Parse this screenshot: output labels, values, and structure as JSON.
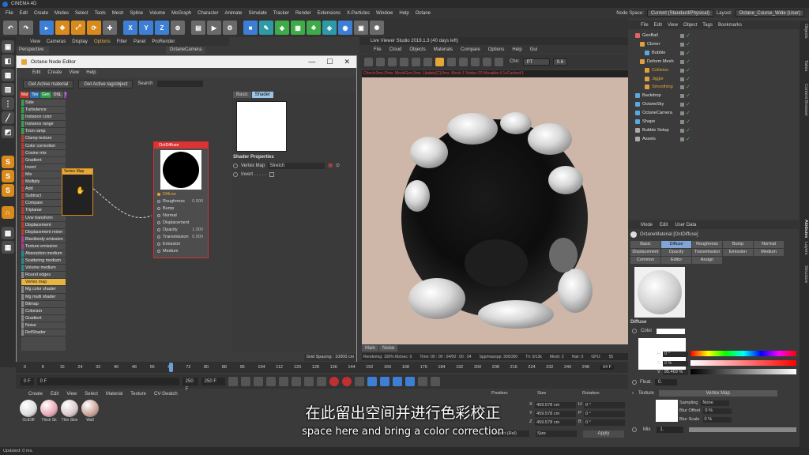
{
  "app": {
    "title": "CINEMA 4D",
    "statusbar": "Updated: 0 ms."
  },
  "menubar": {
    "items": [
      "File",
      "Edit",
      "Create",
      "Modes",
      "Select",
      "Tools",
      "Mesh",
      "Spline",
      "Volume",
      "MoGraph",
      "Character",
      "Animate",
      "Simulate",
      "Tracker",
      "Render",
      "Extensions",
      "X-Particles",
      "Window",
      "Help",
      "Octane"
    ],
    "node_space_label": "Node Space:",
    "node_space_value": "Current (Standard/Physical)",
    "layout_label": "Layout:",
    "layout_value": "Octane_Course_Wide (User)"
  },
  "toolbar": {
    "axis_x": "X",
    "axis_y": "Y",
    "axis_z": "Z"
  },
  "viewport": {
    "menu": [
      "View",
      "Cameras",
      "Display",
      "Options",
      "Filter",
      "Panel",
      "ProRender"
    ],
    "mode": "Perspective",
    "camera": "OctaneCamera"
  },
  "node_editor": {
    "title": "Octane Node Editor",
    "menu": [
      "Edit",
      "Create",
      "View",
      "Help"
    ],
    "get_material_button": "Get Active material",
    "get_tag_button": "Get Active tag/object",
    "search_label": "Search",
    "category_tabs": [
      {
        "label": "Mat",
        "color": "#c0392b"
      },
      {
        "label": "Tex",
        "color": "#2f6fb5"
      },
      {
        "label": "Gen",
        "color": "#2e9a4a"
      },
      {
        "label": "OSL",
        "color": "#555555"
      },
      {
        "label": "Map",
        "color": "#8e44ad"
      },
      {
        "label": "Oth",
        "color": "#7f5a30"
      },
      {
        "label": "Ems",
        "color": "#b03a8e"
      },
      {
        "label": "Med",
        "color": "#2a8a8a"
      },
      {
        "label": "C4D",
        "color": "#222222"
      }
    ],
    "node_list": [
      {
        "label": "Side",
        "color": "#3aa050"
      },
      {
        "label": "Turbulence",
        "color": "#3aa050"
      },
      {
        "label": "Instance color",
        "color": "#3aa050"
      },
      {
        "label": "Instance range",
        "color": "#3aa050"
      },
      {
        "label": "Toon ramp",
        "color": "#3aa050"
      },
      {
        "label": "Clamp texture",
        "color": "#c0392b"
      },
      {
        "label": "Color correction",
        "color": "#c0392b"
      },
      {
        "label": "Cosine mix",
        "color": "#c0392b"
      },
      {
        "label": "Gradient",
        "color": "#c0392b"
      },
      {
        "label": "Invert",
        "color": "#c0392b"
      },
      {
        "label": "Mix",
        "color": "#c0392b"
      },
      {
        "label": "Multiply",
        "color": "#c0392b"
      },
      {
        "label": "Add",
        "color": "#c0392b"
      },
      {
        "label": "Subtract",
        "color": "#c0392b"
      },
      {
        "label": "Compare",
        "color": "#c0392b"
      },
      {
        "label": "Triplanar",
        "color": "#c0392b"
      },
      {
        "label": "Uvw transform",
        "color": "#c0392b"
      },
      {
        "label": "Displacement",
        "color": "#c0392b"
      },
      {
        "label": "Displacement mixer",
        "color": "#c0392b"
      },
      {
        "label": "Blackbody emission",
        "color": "#b03a8e"
      },
      {
        "label": "Texture emission",
        "color": "#b03a8e"
      },
      {
        "label": "Absorption medium",
        "color": "#2a8a8a"
      },
      {
        "label": "Scattering medium",
        "color": "#2a8a8a"
      },
      {
        "label": "Volume medium",
        "color": "#2a8a8a"
      },
      {
        "label": "Round edges",
        "color": "#888888"
      },
      {
        "label": "Vertex map",
        "color": "#e7b341",
        "selected": true
      },
      {
        "label": "Mg color shader",
        "color": "#888888"
      },
      {
        "label": "Mg multi shader",
        "color": "#888888"
      },
      {
        "label": "Bitmap",
        "color": "#888888"
      },
      {
        "label": "Colorizer",
        "color": "#888888"
      },
      {
        "label": "Gradient",
        "color": "#888888"
      },
      {
        "label": "Noise",
        "color": "#888888"
      },
      {
        "label": "RefShader",
        "color": "#888888"
      }
    ],
    "vertex_node_title": "Vertex Map",
    "diffuse_node": {
      "title": "OctDiffuse",
      "ports": [
        {
          "label": "Diffuse",
          "value": "",
          "active": true
        },
        {
          "label": "Roughness",
          "value": "0.000"
        },
        {
          "label": "Bump",
          "value": ""
        },
        {
          "label": "Normal",
          "value": ""
        },
        {
          "label": "Displacement",
          "value": ""
        },
        {
          "label": "Opacity",
          "value": "1.000"
        },
        {
          "label": "Transmission",
          "value": "0.000"
        },
        {
          "label": "Emission",
          "value": ""
        },
        {
          "label": "Medium",
          "value": ""
        }
      ]
    },
    "shader_tabs": [
      "Basic",
      "Shader"
    ],
    "shader_properties_label": "Shader Properties",
    "vertex_map_label": "Vertex Map",
    "vertex_map_value": "Stretch",
    "invert_label": "Invert . . . . .",
    "grid_spacing": "Grid Spacing : 10000 cm"
  },
  "live_viewer": {
    "title": "Live Viewer Studio 2019.1.3 (40 days left)",
    "menu": [
      "File",
      "Cloud",
      "Objects",
      "Materials",
      "Compare",
      "Options",
      "Help",
      "Gui"
    ],
    "channel_label": "Chn:",
    "channel_value": "PT",
    "zoom_value": "0.6",
    "status": "Check:0ms./0ms. MeshGen:2ms. Update[C]:0ms. Mesh:1 Nodes:20 Movable:4 1xCached:1",
    "tabs": [
      "Main",
      "Noise"
    ],
    "footer": [
      "Rendering: 100% Ms/sec: 0",
      "Time: 00 : 00 : 04/00 : 00 : 04",
      "Spp/maxspp: 300/300",
      "Tri: 0/13k",
      "Mesh: 2",
      "Hair: 0",
      "GPU:",
      "55"
    ]
  },
  "object_manager": {
    "menu": [
      "File",
      "Edit",
      "View",
      "Object",
      "Tags",
      "Bookmarks"
    ],
    "objects": [
      {
        "name": "GeoBall",
        "color": "#e06666",
        "indent": 0
      },
      {
        "name": "Cloner",
        "color": "#e0a040",
        "indent": 1
      },
      {
        "name": "Bubble",
        "color": "#5aa8e0",
        "indent": 2
      },
      {
        "name": "Deform Mesh",
        "color": "#e0a040",
        "indent": 1
      },
      {
        "name": "Collision",
        "color": "#e0a040",
        "indent": 2
      },
      {
        "name": "Jiggle",
        "color": "#e0a040",
        "indent": 2
      },
      {
        "name": "Smoothing",
        "color": "#e0a040",
        "indent": 2
      },
      {
        "name": "Backdrop",
        "color": "#5aa8e0",
        "indent": 0
      },
      {
        "name": "OctaneSky",
        "color": "#5aa8e0",
        "indent": 0
      },
      {
        "name": "OctaneCamera",
        "color": "#5aa8e0",
        "indent": 0
      },
      {
        "name": "Shape",
        "color": "#5aa8e0",
        "indent": 0
      },
      {
        "name": "Bubble Setup",
        "color": "#aaaaaa",
        "indent": 0
      },
      {
        "name": "Assets",
        "color": "#aaaaaa",
        "indent": 0
      }
    ]
  },
  "attributes": {
    "menu": [
      "Mode",
      "Edit",
      "User Data"
    ],
    "title": "OctaneMaterial [OctDiffuse]",
    "tabs": [
      "Basic",
      "Diffuse",
      "Roughness",
      "Bump",
      "Normal",
      "Displacement",
      "Opacity",
      "Transmission",
      "Emission",
      "Medium",
      "Common",
      "Editor",
      "Assign"
    ],
    "active_tab": "Diffuse",
    "section": "Diffuse",
    "color_label": "Color",
    "h_label": "H",
    "h_value": "0 °",
    "s_label": "S",
    "s_value": "0 %",
    "v_label": "V",
    "v_value": "95.469 %",
    "float_label": "Float.",
    "float_value": "0.",
    "texture_label": "Texture",
    "texture_value": "Vertex Map",
    "sampling_label": "Sampling",
    "sampling_value": "None",
    "blur_offset_label": "Blur Offset",
    "blur_offset_value": "0 %",
    "blur_scale_label": "Blur Scale",
    "blur_scale_value": "0 %",
    "mix_label": "Mix",
    "mix_value": "1."
  },
  "right_tabs": [
    "Objects",
    "Takes",
    "Content Browser",
    "Layers",
    "Structure",
    "Attributes"
  ],
  "timeline": {
    "ticks": [
      "0",
      "8",
      "16",
      "24",
      "32",
      "40",
      "48",
      "56",
      "64",
      "72",
      "80",
      "88",
      "96",
      "104",
      "112",
      "120",
      "128",
      "136",
      "144",
      "152",
      "160",
      "168",
      "176",
      "184",
      "192",
      "200",
      "208",
      "216",
      "224",
      "232",
      "240",
      "248",
      "F"
    ],
    "current": "64 F",
    "start_a": "0 F",
    "start_b": "0 F",
    "end_a": "250 F",
    "end_b": "250 F"
  },
  "materials": {
    "menu": [
      "Create",
      "Edit",
      "View",
      "Select",
      "Material",
      "Texture",
      "CV-Swatch"
    ],
    "items": [
      {
        "label": "OctDiff",
        "color": "#dcdcdc"
      },
      {
        "label": "Thick Sk",
        "color": "#e8a8b4"
      },
      {
        "label": "Thin Skin",
        "color": "#d8c8c8"
      },
      {
        "label": "Wall",
        "color": "#caa296"
      }
    ]
  },
  "coordinates": {
    "headers": [
      "Position",
      "Size",
      "Rotation"
    ],
    "rows": [
      {
        "axis": "X",
        "pos": "459.578 cm",
        "size_label": "H",
        "rot": "0 °"
      },
      {
        "axis": "Y",
        "pos": "459.578 cm",
        "size_label": "P",
        "rot": "0 °"
      },
      {
        "axis": "Z",
        "pos": "459.578 cm",
        "size_label": "B",
        "rot": "0 °"
      }
    ],
    "mode_a": "Object (Rel)",
    "mode_b": "Size",
    "apply_label": "Apply"
  },
  "subtitle": {
    "zh": "在此留出空间并进行色彩校正",
    "en": "space here and bring a color correction"
  }
}
